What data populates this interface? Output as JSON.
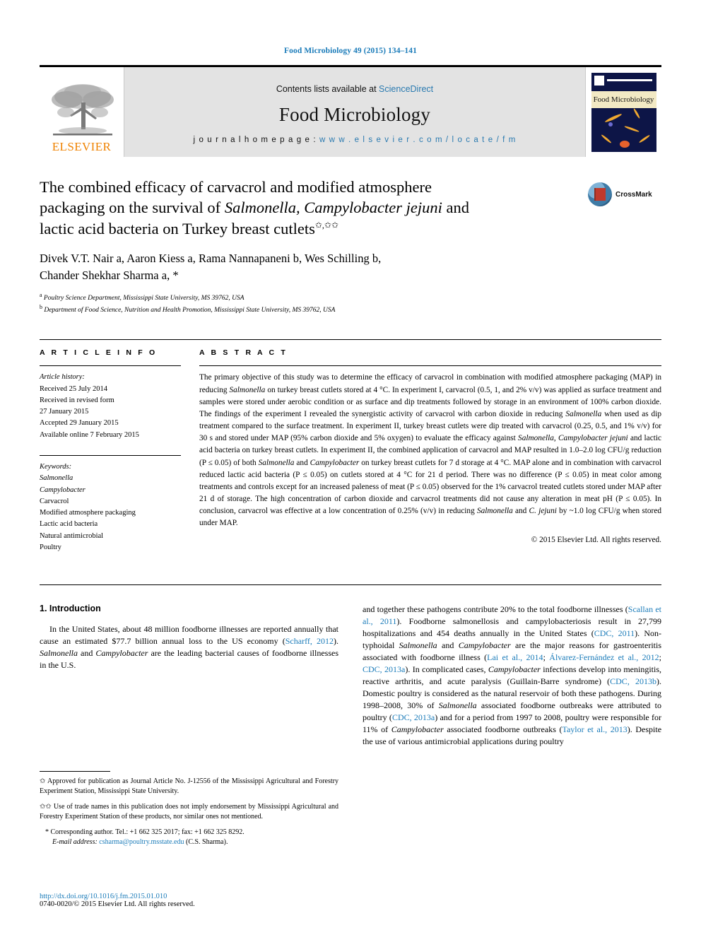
{
  "running_head": "Food Microbiology 49 (2015) 134–141",
  "masthead": {
    "contents_label": "Contents lists available at",
    "sciencedirect": "ScienceDirect",
    "journal_title": "Food Microbiology",
    "homepage_label": "j o u r n a l   h o m e p a g e :",
    "homepage_url": "w w w . e l s e v i e r . c o m / l o c a t e / f m",
    "publisher": "ELSEVIER",
    "cover_title": "Food Microbiology",
    "accent_blue": "#2a7ab0",
    "elsevier_orange": "#ef8200"
  },
  "article": {
    "title_line1": "The combined efficacy of carvacrol and modified atmosphere",
    "title_line2_a": "packaging on the survival of ",
    "title_line2_i": "Salmonella, Campylobacter jejuni",
    "title_line2_b": " and",
    "title_line3": "lactic acid bacteria on Turkey breast cutlets",
    "title_footnote_marks": "✩,✩✩",
    "crossmark_label": "CrossMark",
    "authors_line1": "Divek V.T. Nair a, Aaron Kiess a, Rama Nannapaneni b, Wes Schilling b,",
    "authors_line2": "Chander Shekhar Sharma a, *",
    "affiliation_a": "Poultry Science Department, Mississippi State University, MS 39762, USA",
    "affiliation_b": "Department of Food Science, Nutrition and Health Promotion, Mississippi State University, MS 39762, USA"
  },
  "article_info": {
    "heading": "A R T I C L E   I N F O",
    "history_label": "Article history:",
    "history": [
      "Received 25 July 2014",
      "Received in revised form",
      "27 January 2015",
      "Accepted 29 January 2015",
      "Available online 7 February 2015"
    ],
    "keywords_label": "Keywords:",
    "keywords": [
      "Salmonella",
      "Campylobacter",
      "Carvacrol",
      "Modified atmosphere packaging",
      "Lactic acid bacteria",
      "Natural antimicrobial",
      "Poultry"
    ]
  },
  "abstract": {
    "heading": "A B S T R A C T",
    "text": "The primary objective of this study was to determine the efficacy of carvacrol in combination with modified atmosphere packaging (MAP) in reducing Salmonella on turkey breast cutlets stored at 4 °C. In experiment I, carvacrol (0.5, 1, and 2% v/v) was applied as surface treatment and samples were stored under aerobic condition or as surface and dip treatments followed by storage in an environment of 100% carbon dioxide. The findings of the experiment I revealed the synergistic activity of carvacrol with carbon dioxide in reducing Salmonella when used as dip treatment compared to the surface treatment. In experiment II, turkey breast cutlets were dip treated with carvacrol (0.25, 0.5, and 1% v/v) for 30 s and stored under MAP (95% carbon dioxide and 5% oxygen) to evaluate the efficacy against Salmonella, Campylobacter jejuni and lactic acid bacteria on turkey breast cutlets. In experiment II, the combined application of carvacrol and MAP resulted in 1.0–2.0 log CFU/g reduction (P ≤ 0.05) of both Salmonella and Campylobacter on turkey breast cutlets for 7 d storage at 4 °C. MAP alone and in combination with carvacrol reduced lactic acid bacteria (P ≤ 0.05) on cutlets stored at 4 °C for 21 d period. There was no difference (P ≤ 0.05) in meat color among treatments and controls except for an increased paleness of meat (P ≤ 0.05) observed for the 1% carvacrol treated cutlets stored under MAP after 21 d of storage. The high concentration of carbon dioxide and carvacrol treatments did not cause any alteration in meat pH (P ≤ 0.05). In conclusion, carvacrol was effective at a low concentration of 0.25% (v/v) in reducing Salmonella and C. jejuni by ~1.0 log CFU/g when stored under MAP.",
    "copyright": "© 2015 Elsevier Ltd. All rights reserved."
  },
  "introduction": {
    "heading": "1.  Introduction",
    "left_paragraph": "In the United States, about 48 million foodborne illnesses are reported annually that cause an estimated $77.7 billion annual loss to the US economy (Scharff, 2012). Salmonella and Campylobacter are the leading bacterial causes of foodborne illnesses in the U.S.",
    "right_paragraph": "and together these pathogens contribute 20% to the total foodborne illnesses (Scallan et al., 2011). Foodborne salmonellosis and campylobacteriosis result in 27,799 hospitalizations and 454 deaths annually in the United States (CDC, 2011). Non-typhoidal Salmonella and Campylobacter are the major reasons for gastroenteritis associated with foodborne illness (Lai et al., 2014; Álvarez-Fernández et al., 2012; CDC, 2013a). In complicated cases, Campylobacter infections develop into meningitis, reactive arthritis, and acute paralysis (Guillain-Barre syndrome) (CDC, 2013b). Domestic poultry is considered as the natural reservoir of both these pathogens. During 1998–2008, 30% of Salmonella associated foodborne outbreaks were attributed to poultry (CDC, 2013a) and for a period from 1997 to 2008, poultry were responsible for 11% of Campylobacter associated foodborne outbreaks (Taylor et al., 2013). Despite the use of various antimicrobial applications during poultry"
  },
  "footnotes": {
    "note1_mark": "✩",
    "note1": "Approved for publication as Journal Article No. J-12556 of the Mississippi Agricultural and Forestry Experiment Station, Mississippi State University.",
    "note2_mark": "✩✩",
    "note2": "Use of trade names in this publication does not imply endorsement by Mississippi Agricultural and Forestry Experiment Station of these products, nor similar ones not mentioned.",
    "note3_mark": "*",
    "note3": "Corresponding author. Tel.: +1 662 325 2017; fax: +1 662 325 8292.",
    "email_label": "E-mail address:",
    "email": "csharma@poultry.msstate.edu",
    "email_owner": "(C.S. Sharma)."
  },
  "bottom": {
    "doi": "http://dx.doi.org/10.1016/j.fm.2015.01.010",
    "issn_copyright": "0740-0020/© 2015 Elsevier Ltd. All rights reserved."
  }
}
